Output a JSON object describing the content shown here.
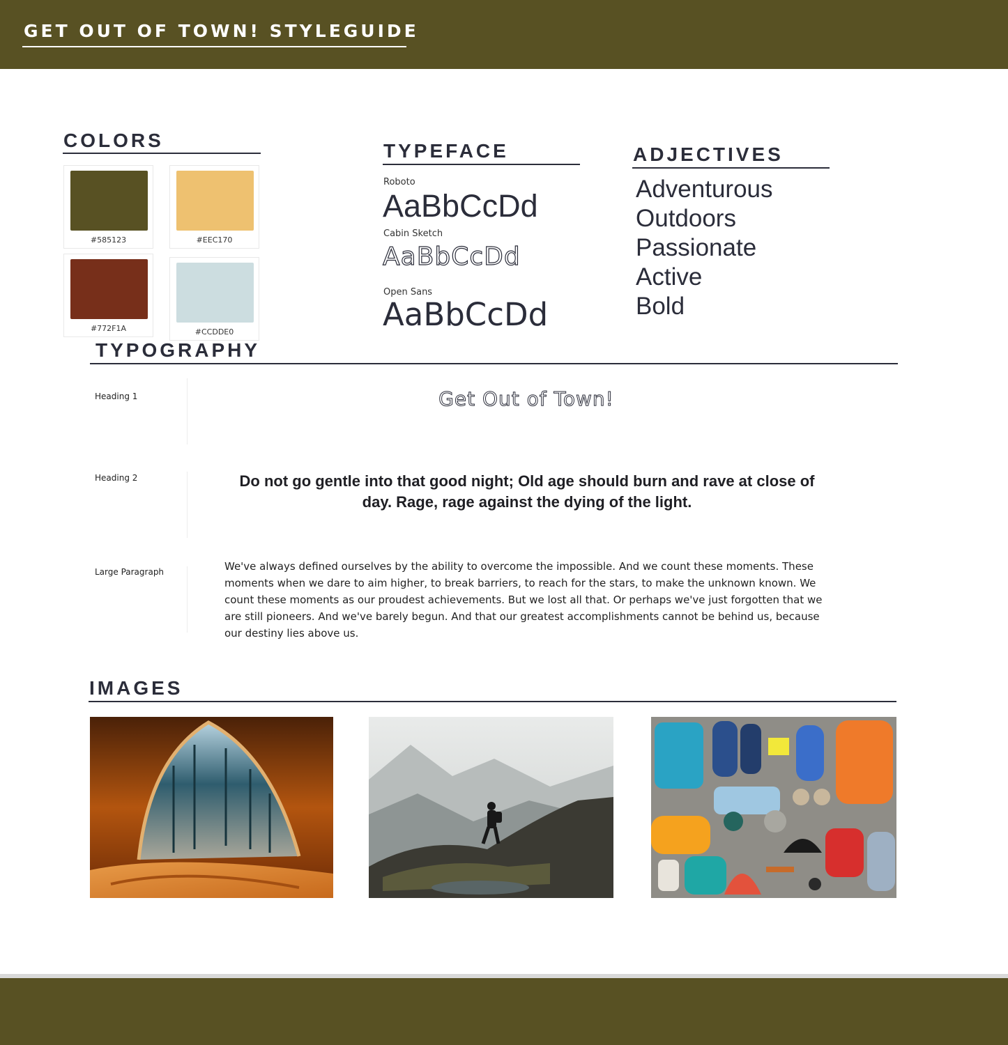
{
  "header": {
    "title": "GET OUT OF TOWN! STYLEGUIDE"
  },
  "colors": {
    "heading": "COLORS",
    "swatches": [
      {
        "label": "#585123",
        "hex": "#585123"
      },
      {
        "label": "#EEC170",
        "hex": "#EEC170"
      },
      {
        "label": "#772F1A",
        "hex": "#772F1A"
      },
      {
        "label": "#CCDDE0",
        "hex": "#CCDDE0"
      }
    ]
  },
  "typeface": {
    "heading": "TYPEFACE",
    "fonts": [
      {
        "name": "Roboto",
        "sample": "AaBbCcDd"
      },
      {
        "name": "Cabin Sketch",
        "sample": "AaBbCcDd"
      },
      {
        "name": "Open Sans",
        "sample": "AaBbCcDd"
      }
    ]
  },
  "adjectives": {
    "heading": "ADJECTIVES",
    "items": [
      "Adventurous",
      "Outdoors",
      "Passionate",
      "Active",
      "Bold"
    ]
  },
  "typography": {
    "heading": "TYPOGRAPHY",
    "rows": [
      {
        "label": "Heading 1",
        "sample": "Get Out of Town!"
      },
      {
        "label": "Heading 2",
        "sample": "Do not go gentle into that good night; Old age should burn and rave at close of day.  Rage, rage against the dying of the light."
      },
      {
        "label": "Large Paragraph",
        "sample": "We've always defined ourselves by the ability to overcome the impossible. And we count these moments. These moments when we dare to aim higher, to break barriers, to reach for the stars, to make the unknown known. We count these moments as our proudest achievements. But we lost all that. Or perhaps we've just forgotten that we are still pioneers. And we've barely begun. And that our greatest accomplishments cannot be behind us, because our destiny lies above us."
      }
    ]
  },
  "images": {
    "heading": "IMAGES",
    "items": [
      {
        "icon": "tent-view-photo"
      },
      {
        "icon": "hiker-mountain-photo"
      },
      {
        "icon": "camping-gear-photo"
      }
    ]
  }
}
